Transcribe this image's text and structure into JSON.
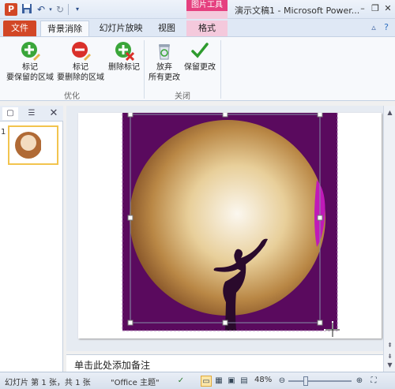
{
  "titlebar": {
    "app_icon": "P",
    "window_title": "演示文稿1 - Microsoft Power...",
    "context_tab_group": "图片工具",
    "icons": [
      "save-icon",
      "undo-icon",
      "redo-icon",
      "customize-qat-icon",
      "minimize-icon",
      "restore-icon",
      "close-icon"
    ]
  },
  "tabs": {
    "file": "文件",
    "background_removal": "背景消除",
    "slideshow": "幻灯片放映",
    "view": "视图",
    "format": "格式"
  },
  "ribbon": {
    "buttons": {
      "mark_keep": [
        "标记",
        "要保留的区域"
      ],
      "mark_remove": [
        "标记",
        "要删除的区域"
      ],
      "delete_mark": "删除标记",
      "discard": [
        "放弃",
        "所有更改"
      ],
      "keep_changes": "保留更改"
    },
    "groups": {
      "refine": "优化",
      "close": "关闭"
    }
  },
  "slides_panel": {
    "slide_number": "1"
  },
  "notes": {
    "placeholder": "单击此处添加备注"
  },
  "statusbar": {
    "slide_info": "幻灯片 第 1 张，共 1 张",
    "theme": "\"Office 主题\"",
    "zoom_level": "48%",
    "zoom_fraction": 0.28
  },
  "colors": {
    "file_tab": "#d24726",
    "context_tab": "#e5407f",
    "removal_overlay": "#5a0a5e",
    "moon": "#d8b070"
  }
}
